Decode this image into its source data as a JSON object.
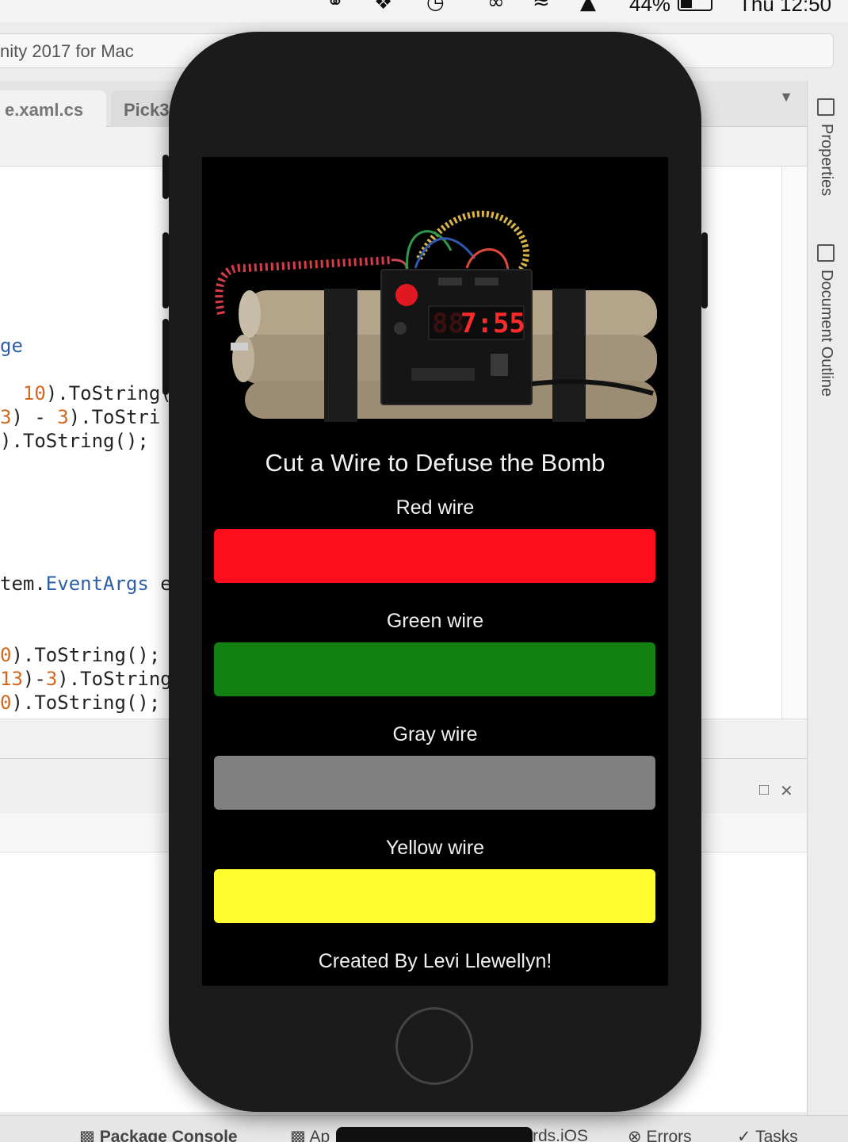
{
  "menubar": {
    "battery_pct": "44%",
    "clock": "Thu 12:50"
  },
  "window": {
    "title": "nity 2017 for Mac"
  },
  "tabs": [
    {
      "label": "e.xaml.cs"
    },
    {
      "label": "Pick3"
    }
  ],
  "code_lines": {
    "l1": "ge",
    "l2_num": "10",
    "l2_rest": ").ToString(",
    "l3_num1": "3",
    "l3_mid": ") - ",
    "l3_num2": "3",
    "l3_rest": ").ToStri",
    "l4": ").ToString();",
    "l5_pre": "tem.",
    "l5_type": "EventArgs",
    "l5_post": " e",
    "l6_num": "0",
    "l6_rest": ").ToString();",
    "l7_num1": "13",
    "l7_mid": ")-",
    "l7_num2": "3",
    "l7_rest": ").ToString",
    "l8_num": "0",
    "l8_rest": ").ToString();"
  },
  "right_panel": {
    "properties": "Properties",
    "outline": "Document Outline"
  },
  "statusbar": {
    "package_console": "Package Console",
    "app": "Ap",
    "ios": "rds.iOS",
    "errors": "Errors",
    "tasks": "Tasks"
  },
  "app": {
    "timer_display": "7:55",
    "title": "Cut a Wire to Defuse the Bomb",
    "wires": [
      {
        "label": "Red wire",
        "color": "#fe0e1a"
      },
      {
        "label": "Green wire",
        "color": "#138112"
      },
      {
        "label": "Gray wire",
        "color": "#808080"
      },
      {
        "label": "Yellow wire",
        "color": "#fffc30"
      }
    ],
    "credit": "Created By Levi Llewellyn!"
  }
}
